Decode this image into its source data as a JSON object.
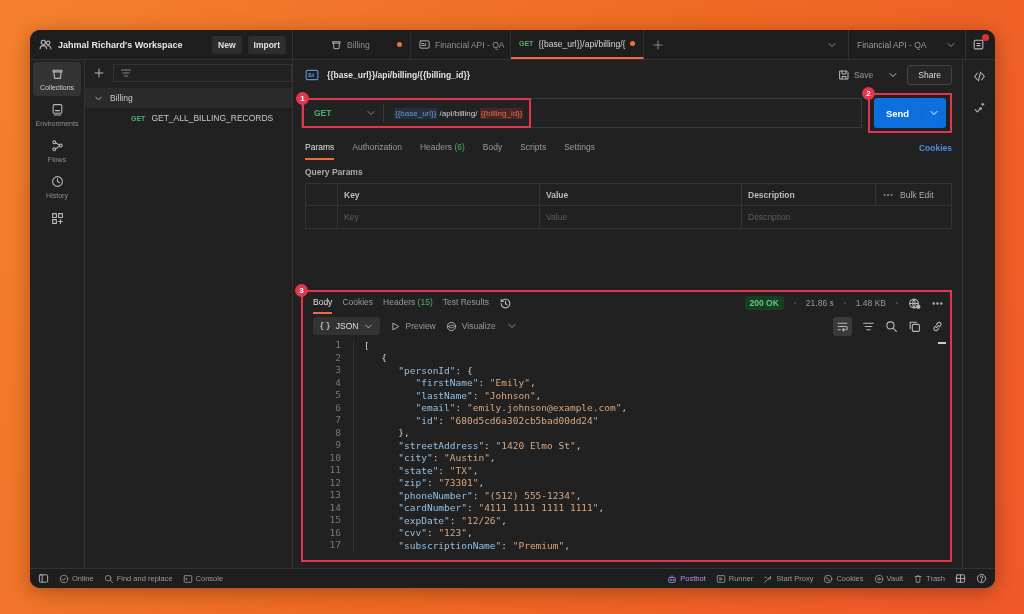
{
  "workspace": {
    "name": "Jahmal Richard's Workspace",
    "buttons": [
      "New",
      "Import"
    ]
  },
  "tabs": [
    {
      "kind": "collection",
      "label": "Billing",
      "unsaved": true,
      "selected": false
    },
    {
      "kind": "api",
      "label": "Financial API - QA",
      "unsaved": false,
      "selected": false
    },
    {
      "kind": "request",
      "method": "GET",
      "label": "{{base_url}}/api/billing/{",
      "unsaved": true,
      "selected": true
    }
  ],
  "environment": "Financial API - QA",
  "rail": [
    {
      "label": "Collections",
      "selected": true
    },
    {
      "label": "Environments",
      "selected": false
    },
    {
      "label": "Flows",
      "selected": false
    },
    {
      "label": "History",
      "selected": false
    }
  ],
  "sidebar": {
    "tree": [
      {
        "label": "Billing",
        "expanded": true,
        "children": [
          {
            "method": "GET",
            "label": "GET_ALL_BILLING_RECORDS"
          }
        ]
      }
    ]
  },
  "request": {
    "title": "{{base_url}}/api/billing/{{billing_id}}",
    "save": "Save",
    "share": "Share",
    "method": "GET",
    "url": [
      {
        "kind": "var",
        "text": "{{base_url}}"
      },
      {
        "kind": "text",
        "text": " /api/billing/ "
      },
      {
        "kind": "missing_var",
        "text": "{{billing_id}}"
      }
    ],
    "send": "Send",
    "tabs": [
      {
        "label": "Params",
        "selected": true
      },
      {
        "label": "Authorization",
        "selected": false
      },
      {
        "label": "Headers",
        "count": "(6)",
        "selected": false
      },
      {
        "label": "Body",
        "selected": false
      },
      {
        "label": "Scripts",
        "selected": false
      },
      {
        "label": "Settings",
        "selected": false
      }
    ],
    "cookies": "Cookies",
    "params": {
      "title": "Query Params",
      "columns": [
        "Key",
        "Value",
        "Description"
      ],
      "bulk_edit": "Bulk Edit",
      "placeholders": [
        "Key",
        "Value",
        "Description"
      ]
    }
  },
  "response": {
    "tabs": [
      {
        "label": "Body",
        "selected": true
      },
      {
        "label": "Cookies",
        "selected": false
      },
      {
        "label": "Headers",
        "count": "(15)",
        "selected": false
      },
      {
        "label": "Test Results",
        "selected": false
      }
    ],
    "status": "200 OK",
    "time": "21.86 s",
    "size": "1.48 KB",
    "format_symbol": "{}",
    "format": "JSON",
    "views": [
      "Preview",
      "Visualize"
    ],
    "lines": [
      {
        "n": "1",
        "t": [
          {
            "kind": "p",
            "text": "["
          }
        ]
      },
      {
        "n": "2",
        "t": [
          {
            "kind": "p",
            "text": "   {"
          }
        ]
      },
      {
        "n": "3",
        "t": [
          {
            "kind": "key",
            "text": "      \"personId\""
          },
          {
            "kind": "p",
            "text": ": {"
          }
        ]
      },
      {
        "n": "4",
        "t": [
          {
            "kind": "key",
            "text": "         \"firstName\""
          },
          {
            "kind": "p",
            "text": ": "
          },
          {
            "kind": "str",
            "text": "\"Emily\""
          },
          {
            "kind": "p",
            "text": ","
          }
        ]
      },
      {
        "n": "5",
        "t": [
          {
            "kind": "key",
            "text": "         \"lastName\""
          },
          {
            "kind": "p",
            "text": ": "
          },
          {
            "kind": "str",
            "text": "\"Johnson\""
          },
          {
            "kind": "p",
            "text": ","
          }
        ]
      },
      {
        "n": "6",
        "t": [
          {
            "kind": "key",
            "text": "         \"email\""
          },
          {
            "kind": "p",
            "text": ": "
          },
          {
            "kind": "str",
            "text": "\"emily.johnson@example.com\""
          },
          {
            "kind": "p",
            "text": ","
          }
        ]
      },
      {
        "n": "7",
        "t": [
          {
            "kind": "key",
            "text": "         \"id\""
          },
          {
            "kind": "p",
            "text": ": "
          },
          {
            "kind": "str",
            "text": "\"680d5cd6a302cb5bad00dd24\""
          }
        ]
      },
      {
        "n": "8",
        "t": [
          {
            "kind": "p",
            "text": "      },"
          }
        ]
      },
      {
        "n": "9",
        "t": [
          {
            "kind": "key",
            "text": "      \"streetAddress\""
          },
          {
            "kind": "p",
            "text": ": "
          },
          {
            "kind": "str",
            "text": "\"1420 Elmo St\""
          },
          {
            "kind": "p",
            "text": ","
          }
        ]
      },
      {
        "n": "10",
        "t": [
          {
            "kind": "key",
            "text": "      \"city\""
          },
          {
            "kind": "p",
            "text": ": "
          },
          {
            "kind": "str",
            "text": "\"Austin\""
          },
          {
            "kind": "p",
            "text": ","
          }
        ]
      },
      {
        "n": "11",
        "t": [
          {
            "kind": "key",
            "text": "      \"state\""
          },
          {
            "kind": "p",
            "text": ": "
          },
          {
            "kind": "str",
            "text": "\"TX\""
          },
          {
            "kind": "p",
            "text": ","
          }
        ]
      },
      {
        "n": "12",
        "t": [
          {
            "kind": "key",
            "text": "      \"zip\""
          },
          {
            "kind": "p",
            "text": ": "
          },
          {
            "kind": "str",
            "text": "\"73301\""
          },
          {
            "kind": "p",
            "text": ","
          }
        ]
      },
      {
        "n": "13",
        "t": [
          {
            "kind": "key",
            "text": "      \"phoneNumber\""
          },
          {
            "kind": "p",
            "text": ": "
          },
          {
            "kind": "str",
            "text": "\"(512) 555-1234\""
          },
          {
            "kind": "p",
            "text": ","
          }
        ]
      },
      {
        "n": "14",
        "t": [
          {
            "kind": "key",
            "text": "      \"cardNumber\""
          },
          {
            "kind": "p",
            "text": ": "
          },
          {
            "kind": "str",
            "text": "\"4111 1111 1111 1111\""
          },
          {
            "kind": "p",
            "text": ","
          }
        ]
      },
      {
        "n": "15",
        "t": [
          {
            "kind": "key",
            "text": "      \"expDate\""
          },
          {
            "kind": "p",
            "text": ": "
          },
          {
            "kind": "str",
            "text": "\"12/26\""
          },
          {
            "kind": "p",
            "text": ","
          }
        ]
      },
      {
        "n": "16",
        "t": [
          {
            "kind": "key",
            "text": "      \"cvv\""
          },
          {
            "kind": "p",
            "text": ": "
          },
          {
            "kind": "str",
            "text": "\"123\""
          },
          {
            "kind": "p",
            "text": ","
          }
        ]
      },
      {
        "n": "17",
        "t": [
          {
            "kind": "key",
            "text": "      \"subscriptionName\""
          },
          {
            "kind": "p",
            "text": ": "
          },
          {
            "kind": "str",
            "text": "\"Premium\""
          },
          {
            "kind": "p",
            "text": ","
          }
        ]
      }
    ]
  },
  "status_bar": {
    "left": [
      "Online",
      "Find and replace",
      "Console"
    ],
    "right": [
      "Postbot",
      "Runner",
      "Start Proxy",
      "Cookies",
      "Vault",
      "Trash"
    ]
  },
  "annotations": [
    "1",
    "2",
    "3"
  ]
}
